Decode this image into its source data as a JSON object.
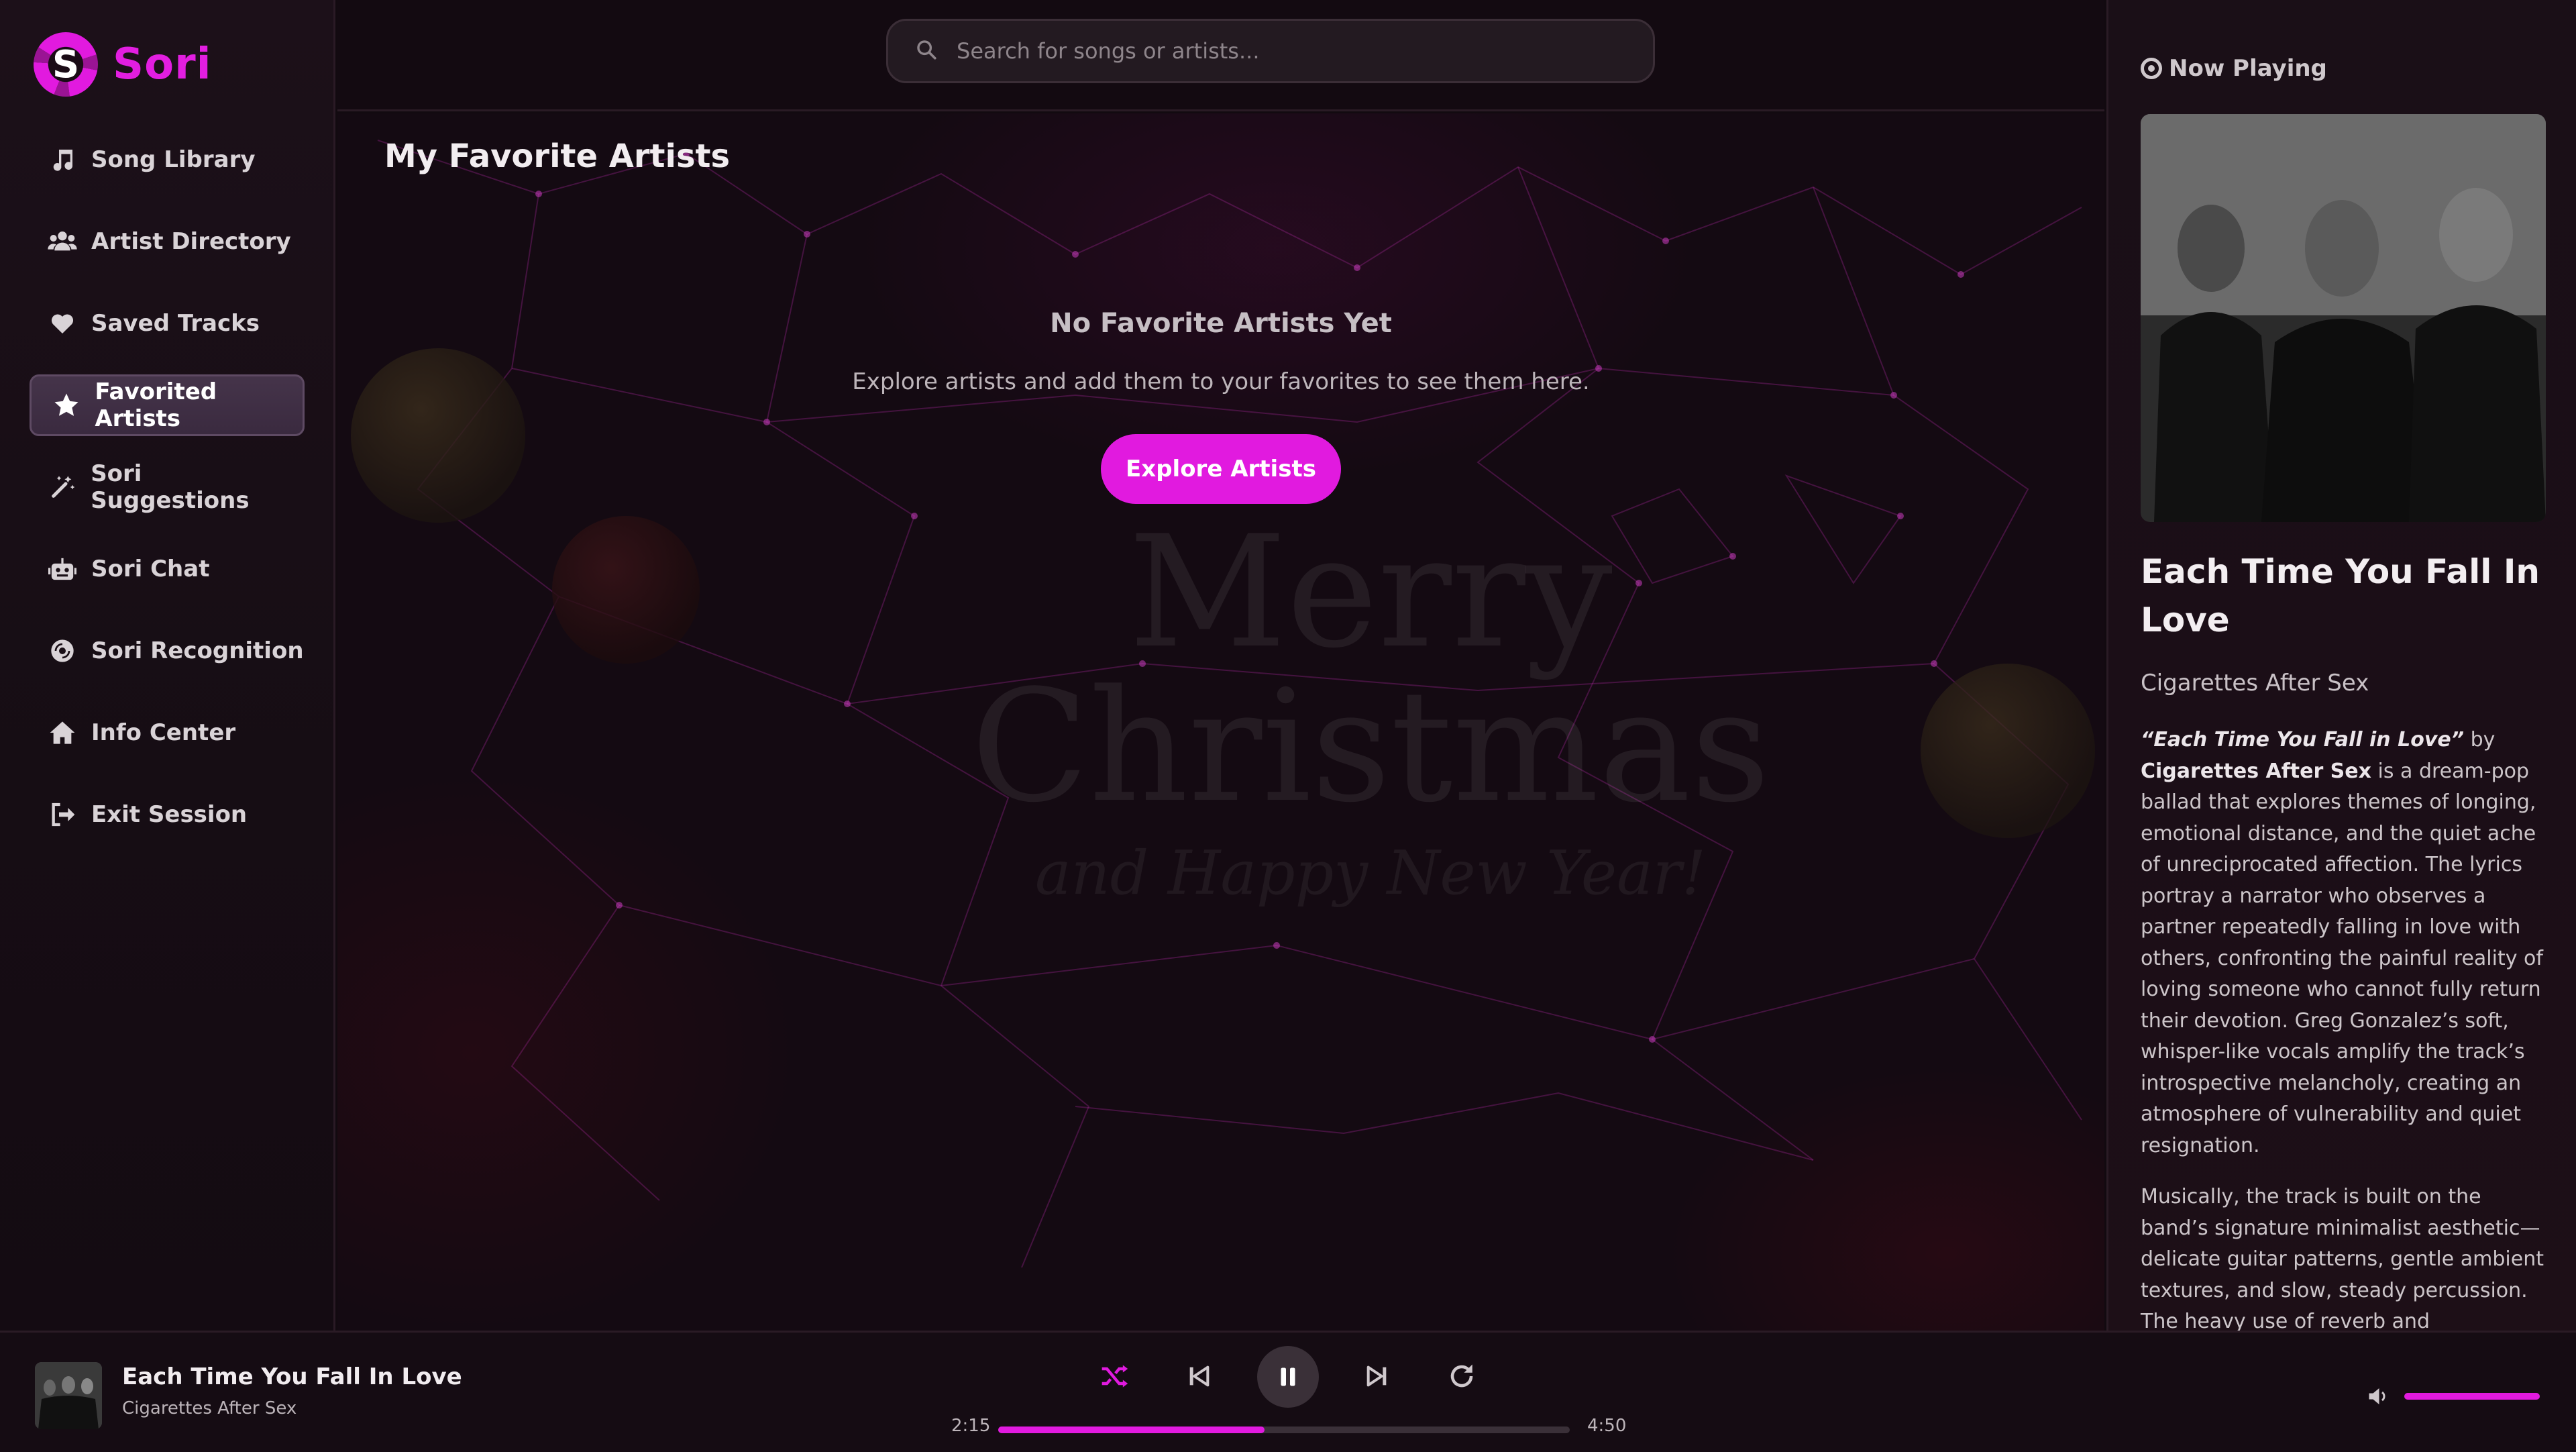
{
  "app": {
    "name": "Sori",
    "logo_letter": "S",
    "accent": "#e11adf"
  },
  "sidebar": {
    "items": [
      {
        "label": "Song Library",
        "icon": "music-note-icon"
      },
      {
        "label": "Artist Directory",
        "icon": "users-icon"
      },
      {
        "label": "Saved Tracks",
        "icon": "heart-icon"
      },
      {
        "label": "Favorited Artists",
        "icon": "star-icon",
        "active": true
      },
      {
        "label": "Sori Suggestions",
        "icon": "magic-wand-icon"
      },
      {
        "label": "Sori Chat",
        "icon": "robot-icon"
      },
      {
        "label": "Sori Recognition",
        "icon": "record-icon"
      },
      {
        "label": "Info Center",
        "icon": "home-icon"
      },
      {
        "label": "Exit Session",
        "icon": "logout-icon"
      }
    ]
  },
  "search": {
    "placeholder": "Search for songs or artists..."
  },
  "main": {
    "title": "My Favorite Artists",
    "empty_title": "No Favorite Artists Yet",
    "empty_subtitle": "Explore artists and add them to your favorites to see them here.",
    "explore_button": "Explore Artists",
    "background_text": {
      "line1": "Merry",
      "line2": "Christmas",
      "line3": "and Happy New Year!"
    }
  },
  "now_playing": {
    "heading": "Now Playing",
    "title": "Each Time You Fall In Love",
    "artist": "Cigarettes After Sex",
    "desc_song": "“Each Time You Fall in Love”",
    "desc_by": " by ",
    "desc_band": "Cigarettes After Sex",
    "desc_p1_rest": " is a dream-pop ballad that explores themes of longing, emotional distance, and the quiet ache of unreciprocated affection. The lyrics portray a narrator who observes a partner repeatedly falling in love with others, confronting the painful reality of loving someone who cannot fully return their devotion. Greg Gonzalez’s soft, whisper-like vocals amplify the track’s introspective melancholy, creating an atmosphere of vulnerability and quiet resignation.",
    "desc_p2": "Musically, the track is built on the band’s signature minimalist aesthetic—delicate guitar patterns, gentle ambient textures, and slow, steady percussion. The heavy use of reverb and atmospheric layering"
  },
  "player": {
    "title": "Each Time You Fall In Love",
    "artist": "Cigarettes After Sex",
    "elapsed": "2:15",
    "duration": "4:50",
    "progress_fraction": 0.466,
    "volume_fraction": 1.0
  }
}
